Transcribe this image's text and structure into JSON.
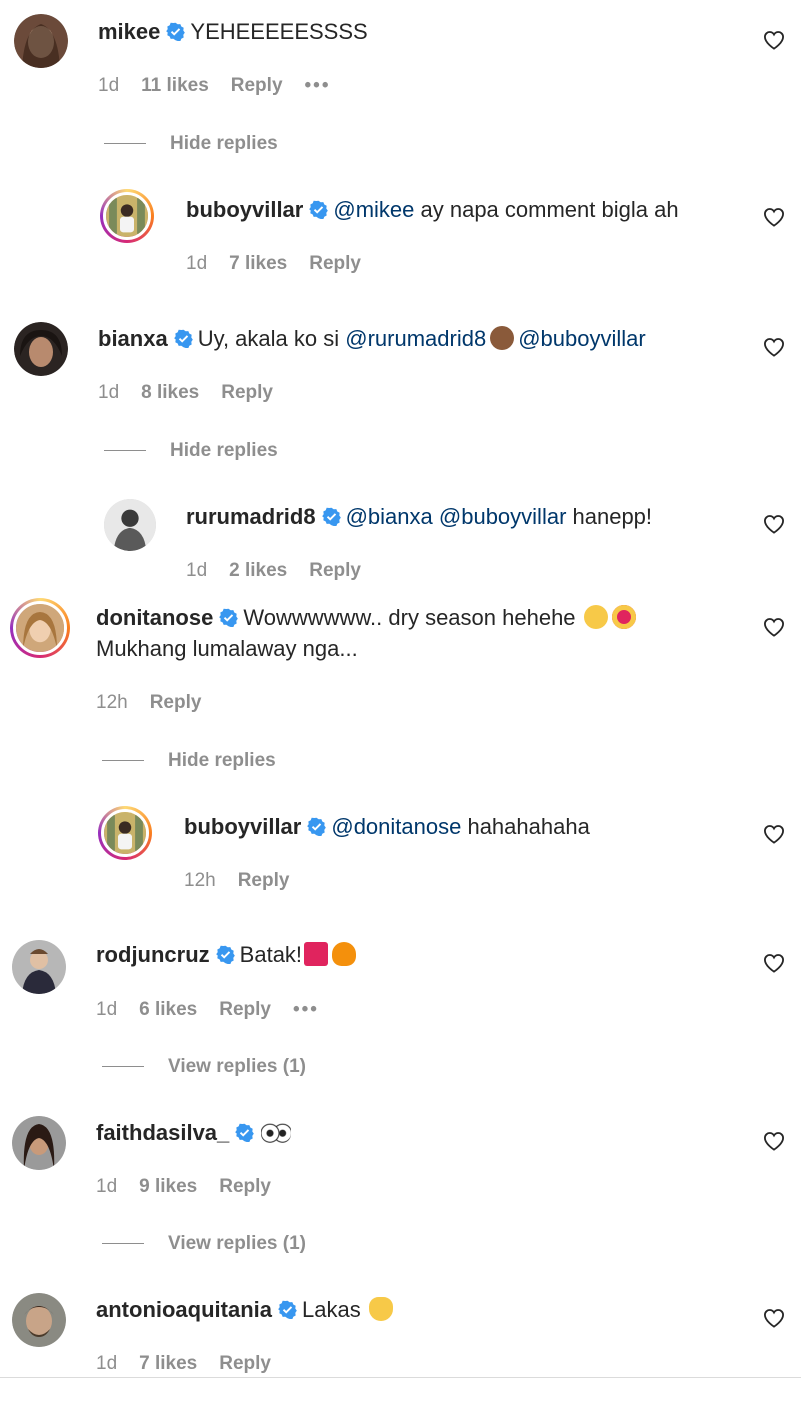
{
  "comments": [
    {
      "user": "mikee",
      "text": "YEHEEEEESSSS",
      "time": "1d",
      "likes": "11 likes",
      "reply": "Reply",
      "more": "•••",
      "hide_replies": "Hide replies",
      "reply_item": {
        "user": "buboyvillar",
        "mention": "@mikee",
        "text": " ay napa comment bigla ah",
        "time": "1d",
        "likes": "7 likes",
        "reply": "Reply"
      }
    },
    {
      "user": "bianxa",
      "text_1": "Uy, akala ko si ",
      "mention_1": "@rurumadrid8",
      "mention_2": "@buboyvillar",
      "time": "1d",
      "likes": "8 likes",
      "reply": "Reply",
      "hide_replies": "Hide replies",
      "reply_item": {
        "user": "rurumadrid8",
        "mention_1": "@bianxa",
        "mention_2": "@buboyvillar",
        "text": " hanepp!",
        "time": "1d",
        "likes": "2 likes",
        "reply": "Reply"
      }
    },
    {
      "user": "donitanose",
      "text_1": "Wowwwwww.. dry season hehehe",
      "text_2": "Mukhang lumalaway nga...",
      "time": "12h",
      "reply": "Reply",
      "hide_replies": "Hide replies",
      "reply_item": {
        "user": "buboyvillar",
        "mention": "@donitanose",
        "text": " hahahahaha",
        "time": "12h",
        "reply": "Reply"
      }
    },
    {
      "user": "rodjuncruz",
      "text": "Batak!",
      "time": "1d",
      "likes": "6 likes",
      "reply": "Reply",
      "more": "•••",
      "view_replies": "View replies (1)"
    },
    {
      "user": "faithdasilva_",
      "time": "1d",
      "likes": "9 likes",
      "reply": "Reply",
      "view_replies": "View replies (1)"
    },
    {
      "user": "antonioaquitania",
      "text": "Lakas",
      "time": "1d",
      "likes": "7 likes",
      "reply": "Reply"
    }
  ],
  "colors": {
    "verified": "#3897f0",
    "mention": "#00376b",
    "meta": "#8e8e8e"
  },
  "icons": {
    "verified": "verified-badge-icon",
    "like": "heart-outline-icon",
    "more": "more-options-icon"
  }
}
